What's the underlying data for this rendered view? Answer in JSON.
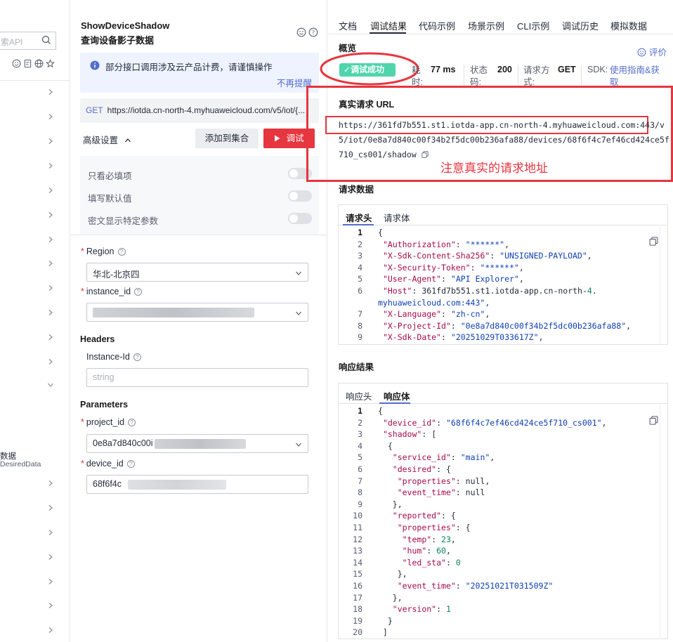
{
  "sidebar": {
    "search_placeholder": "索API",
    "item_text_1": "数据",
    "item_text_2": "DesiredData"
  },
  "api": {
    "name": "ShowDeviceShadow",
    "title_cn": "查询设备影子数据",
    "notice": "部分接口调用涉及云产品计费，请谨慎操作",
    "notice_dismiss": "不再提醒",
    "method": "GET",
    "url_preview": "https://iotda.cn-north-4.myhuaweicloud.com/v5/iot/{...",
    "advanced_label": "高级设置",
    "add_to_collection": "添加到集合",
    "debug_button": "调试",
    "options": [
      "只看必填项",
      "填写默认值",
      "密文显示特定参数"
    ]
  },
  "form": {
    "region_label": "Region",
    "region_value": "华北-北京四",
    "instance_label": "instance_id",
    "headers_title": "Headers",
    "instance_header_label": "Instance-Id",
    "instance_header_placeholder": "string",
    "parameters_title": "Parameters",
    "project_label": "project_id",
    "project_value": "0e8a7d840c00i",
    "device_label": "device_id",
    "device_value": "68f6f4c"
  },
  "right": {
    "tabs": [
      "文档",
      "调试结果",
      "代码示例",
      "场景示例",
      "CLI示例",
      "调试历史",
      "模拟数据"
    ],
    "overview": "概览",
    "rate": "评价",
    "status_badge": "✓调试成功",
    "time_label": "耗时:",
    "time_value": "77 ms",
    "status_label": "状态码:",
    "status_value": "200",
    "method_label": "请求方式:",
    "method_value": "GET",
    "sdk_label": "SDK:",
    "sdk_link": "使用指南&获取",
    "real_url_title": "真实请求 URL",
    "real_url": "https://361fd7b551.st1.iotda-app.cn-north-4.myhuaweicloud.com:443/v5/iot/0e8a7d840c00f34b2f5dc00b236afa88/devices/68f6f4c7ef46cd424ce5f710_cs001/shadow",
    "annotation": "注意真实的请求地址",
    "request_title": "请求数据",
    "request_tabs": [
      "请求头",
      "请求体"
    ],
    "response_title": "响应结果",
    "response_tabs": [
      "响应头",
      "响应体"
    ]
  },
  "request_lines": [
    {
      "n": "1",
      "t": "{"
    },
    {
      "n": "2",
      "t": " \"Authorization\": \"******\","
    },
    {
      "n": "3",
      "t": " \"X-Sdk-Content-Sha256\": \"UNSIGNED-PAYLOAD\","
    },
    {
      "n": "4",
      "t": " \"X-Security-Token\": \"******\","
    },
    {
      "n": "5",
      "t": " \"User-Agent\": \"API Explorer\","
    },
    {
      "n": "6",
      "t": " \"Host\": \"361fd7b551.st1.iotda-app.cn-north-4."
    },
    {
      "n": "",
      "t": "myhuaweicloud.com:443\","
    },
    {
      "n": "7",
      "t": " \"X-Language\": \"zh-cn\","
    },
    {
      "n": "8",
      "t": " \"X-Project-Id\": \"0e8a7d840c00f34b2f5dc00b236afa88\","
    },
    {
      "n": "9",
      "t": " \"X-Sdk-Date\": \"20251029T033617Z\","
    }
  ],
  "response_lines": [
    {
      "n": "1",
      "t": "{"
    },
    {
      "n": "2",
      "t": " \"device_id\": \"68f6f4c7ef46cd424ce5f710_cs001\","
    },
    {
      "n": "3",
      "t": " \"shadow\": ["
    },
    {
      "n": "4",
      "t": "  {"
    },
    {
      "n": "5",
      "t": "   \"service_id\": \"main\","
    },
    {
      "n": "6",
      "t": "   \"desired\": {"
    },
    {
      "n": "7",
      "t": "    \"properties\": null,"
    },
    {
      "n": "8",
      "t": "    \"event_time\": null"
    },
    {
      "n": "9",
      "t": "   },"
    },
    {
      "n": "10",
      "t": "   \"reported\": {"
    },
    {
      "n": "11",
      "t": "    \"properties\": {"
    },
    {
      "n": "12",
      "t": "     \"temp\": 23,"
    },
    {
      "n": "13",
      "t": "     \"hum\": 60,"
    },
    {
      "n": "14",
      "t": "     \"led_sta\": 0"
    },
    {
      "n": "15",
      "t": "    },"
    },
    {
      "n": "16",
      "t": "    \"event_time\": \"20251021T031509Z\""
    },
    {
      "n": "17",
      "t": "   },"
    },
    {
      "n": "18",
      "t": "   \"version\": 1"
    },
    {
      "n": "19",
      "t": "  }"
    },
    {
      "n": "20",
      "t": " ]"
    }
  ]
}
